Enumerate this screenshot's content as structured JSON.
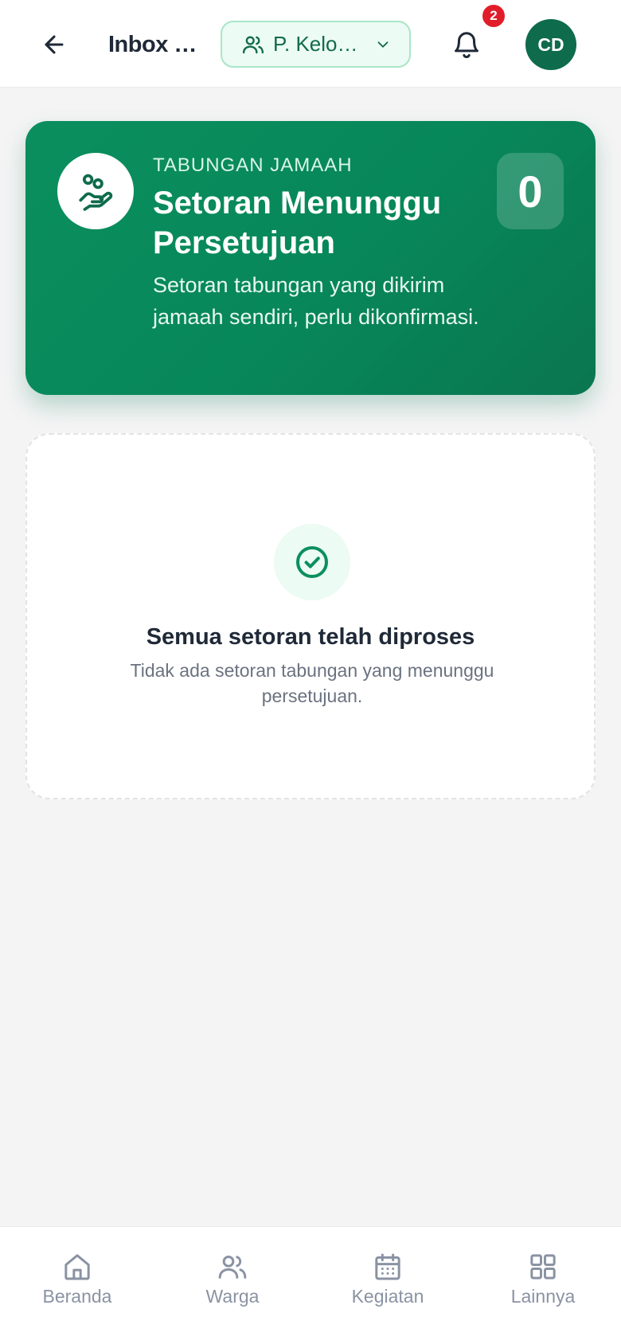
{
  "header": {
    "title": "Inbox Tabungan",
    "group_select": {
      "value": "P. Kelompok"
    },
    "notification_count": "2",
    "avatar_initials": "CD"
  },
  "hero": {
    "eyebrow": "TABUNGAN JAMAAH",
    "title": "Setoran Menunggu Persetujuan",
    "description": "Setoran tabungan yang dikirim jamaah sendiri, perlu dikonfirmasi.",
    "count": "0"
  },
  "empty_state": {
    "title": "Semua setoran telah diproses",
    "description": "Tidak ada setoran tabungan yang menunggu persetujuan."
  },
  "bottom_nav": {
    "items": [
      {
        "label": "Beranda",
        "icon": "home-icon"
      },
      {
        "label": "Warga",
        "icon": "users-icon"
      },
      {
        "label": "Kegiatan",
        "icon": "calendar-icon"
      },
      {
        "label": "Lainnya",
        "icon": "grid-icon"
      }
    ]
  },
  "colors": {
    "brand_green": "#0b8f5e",
    "badge_red": "#e11d2a",
    "background": "#f4f4f5"
  }
}
